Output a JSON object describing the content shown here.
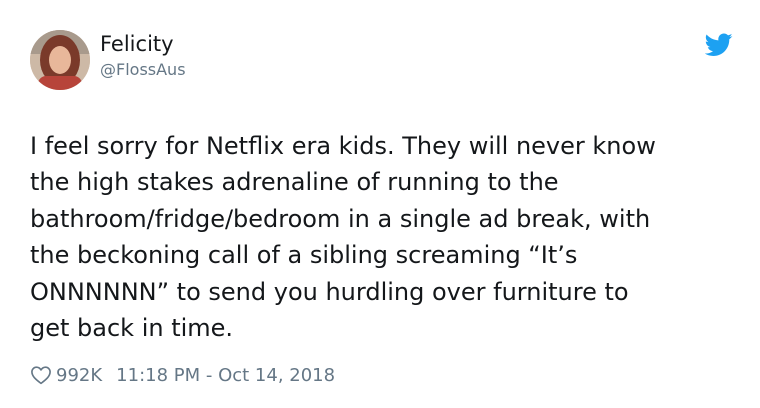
{
  "user": {
    "display_name": "Felicity",
    "handle": "@FlossAus",
    "avatar_icon": "profile-photo",
    "brand_icon": "twitter-bird-icon",
    "brand_color": "#1da1f2"
  },
  "tweet": {
    "lines": [
      "I feel sorry for Netflix era kids. They will never know",
      "the high stakes adrenaline of running to the",
      "bathroom/fridge/bedroom in a single ad break, with",
      "the beckoning call of a sibling screaming “It’s",
      "ONNNNNN” to send you hurdling over furniture to",
      "get back in time."
    ]
  },
  "footer": {
    "like_icon": "heart-outline-icon",
    "likes": "992K",
    "timestamp": "11:18 PM - Oct 14, 2018"
  }
}
